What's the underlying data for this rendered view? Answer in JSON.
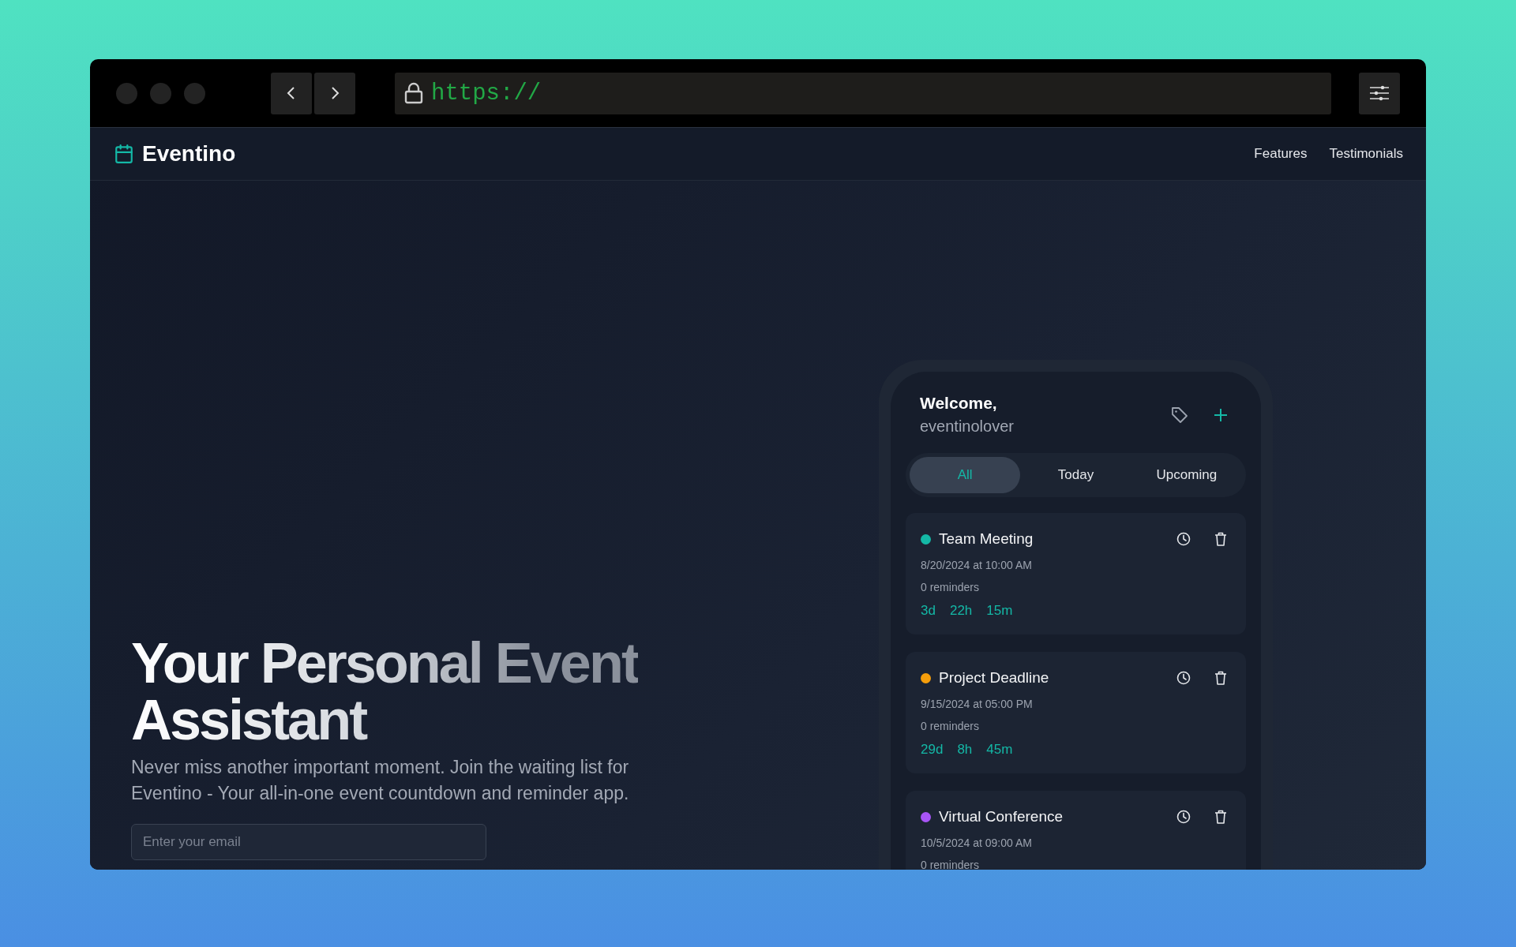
{
  "browser": {
    "url": "https://"
  },
  "nav": {
    "brand": "Eventino",
    "links": [
      "Features",
      "Testimonials"
    ]
  },
  "hero": {
    "title_lines": [
      "Your Personal Event",
      "Assistant"
    ],
    "subtitle": "Never miss another important moment. Join the waiting list for Eventino - Your all-in-one event countdown and reminder app.",
    "email": {
      "placeholder": "Enter your email"
    }
  },
  "app": {
    "greeting": "Welcome,",
    "username": "eventinolover",
    "tabs": [
      {
        "label": "All",
        "selected": true
      },
      {
        "label": "Today",
        "selected": false
      },
      {
        "label": "Upcoming",
        "selected": false
      }
    ],
    "events": [
      {
        "title": "Team Meeting",
        "color": "#14b8a6",
        "date": "8/20/2024 at 10:00 AM",
        "reminders": "0 reminders",
        "countdown": [
          "3d",
          "22h",
          "15m"
        ]
      },
      {
        "title": "Project Deadline",
        "color": "#f59e0b",
        "date": "9/15/2024 at 05:00 PM",
        "reminders": "0 reminders",
        "countdown": [
          "29d",
          "8h",
          "45m"
        ]
      },
      {
        "title": "Virtual Conference",
        "color": "#a855f7",
        "date": "10/5/2024 at 09:00 AM",
        "reminders": "0 reminders"
      }
    ]
  }
}
